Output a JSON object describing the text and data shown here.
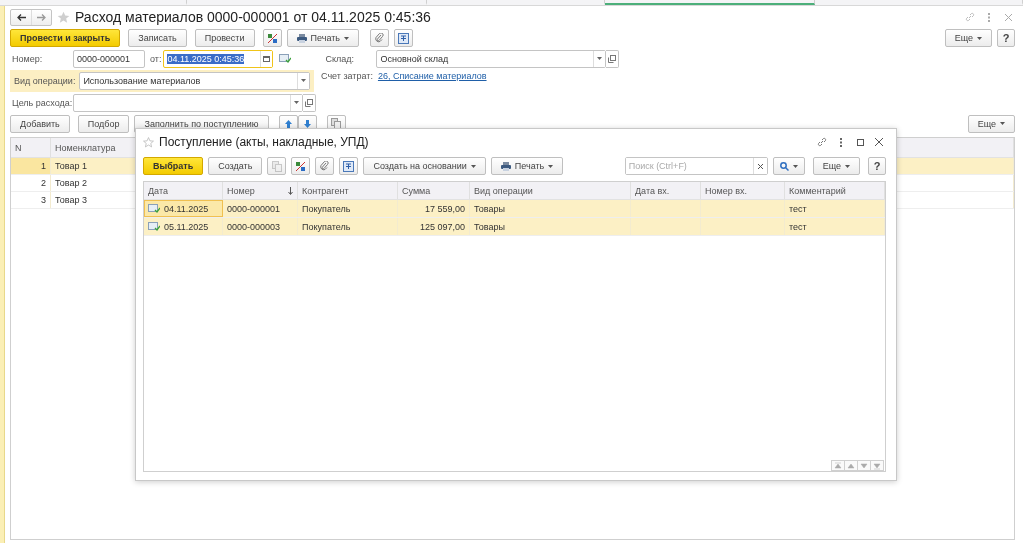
{
  "top_tabs": [
    {
      "selected": false
    },
    {
      "selected": false
    },
    {
      "selected": false
    },
    {
      "selected": true
    },
    {
      "selected": false
    }
  ],
  "form": {
    "title": "Расход материалов 0000-000001 от 04.11.2025 0:45:36",
    "toolbar": {
      "post_close": "Провести и закрыть",
      "write": "Записать",
      "post": "Провести",
      "print": "Печать",
      "more": "Еще",
      "help": "?"
    },
    "number": {
      "label": "Номер:",
      "value": "0000-000001"
    },
    "date": {
      "label": "от:",
      "value": "04.11.2025  0:45:36",
      "focused": true
    },
    "warehouse": {
      "label": "Склад:",
      "value": "Основной склад"
    },
    "operation": {
      "label": "Вид операции:",
      "value": "Использование материалов",
      "highlighted": true
    },
    "cost_account": {
      "label": "Счет затрат:",
      "link": "26, Списание материалов"
    },
    "purpose": {
      "label": "Цель расхода:"
    },
    "table_toolbar": {
      "add": "Добавить",
      "pick": "Подбор",
      "fill": "Заполнить по поступлению",
      "more": "Еще"
    },
    "table": {
      "columns": [
        "N",
        "Номенклатура"
      ],
      "rows": [
        {
          "n": "1",
          "item": "Товар 1",
          "selected": true
        },
        {
          "n": "2",
          "item": "Товар 2",
          "selected": false
        },
        {
          "n": "3",
          "item": "Товар 3",
          "selected": false
        }
      ]
    }
  },
  "dialog": {
    "title": "Поступление (акты, накладные, УПД)",
    "toolbar": {
      "select": "Выбрать",
      "create": "Создать",
      "create_based": "Создать на основании",
      "print": "Печать",
      "search_placeholder": "Поиск (Ctrl+F)",
      "more": "Еще",
      "help": "?"
    },
    "columns": [
      {
        "label": "Дата",
        "sorted": false
      },
      {
        "label": "Номер",
        "sorted": true
      },
      {
        "label": "Контрагент",
        "sorted": false
      },
      {
        "label": "Сумма",
        "sorted": false
      },
      {
        "label": "Вид операции",
        "sorted": false
      },
      {
        "label": "Дата вх.",
        "sorted": false
      },
      {
        "label": "Номер вх.",
        "sorted": false
      },
      {
        "label": "Комментарий",
        "sorted": false
      }
    ],
    "rows": [
      {
        "date": "04.11.2025",
        "number": "0000-000001",
        "counterparty": "Покупатель",
        "sum": "17 559,00",
        "operation": "Товары",
        "comment": "тест",
        "selected": true,
        "current": true
      },
      {
        "date": "05.11.2025",
        "number": "0000-000003",
        "counterparty": "Покупатель",
        "sum": "125 097,00",
        "operation": "Товары",
        "comment": "тест",
        "selected": true,
        "current": false
      }
    ]
  }
}
